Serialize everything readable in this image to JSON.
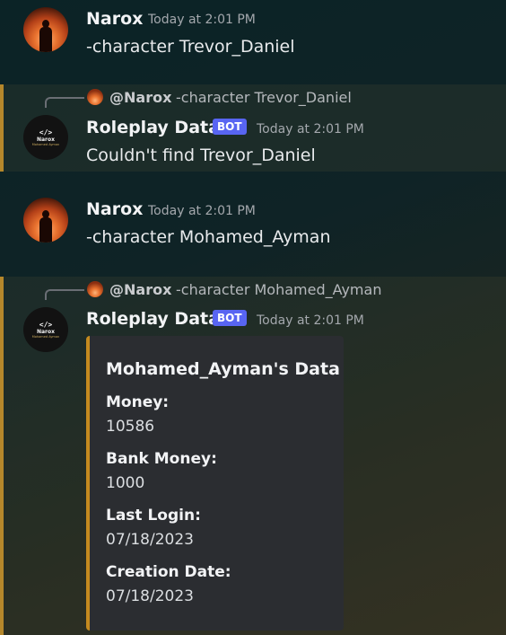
{
  "messages": [
    {
      "author": "Narox",
      "timestamp": "Today at 2:01 PM",
      "content": "-character Trevor_Daniel"
    },
    {
      "reply": {
        "user": "@Narox",
        "text": "-character Trevor_Daniel"
      },
      "author": "Roleplay Data",
      "badge": "BOT",
      "timestamp": "Today at 2:01 PM",
      "content": "Couldn't find Trevor_Daniel"
    },
    {
      "author": "Narox",
      "timestamp": "Today at 2:01 PM",
      "content": "-character Mohamed_Ayman"
    },
    {
      "reply": {
        "user": "@Narox",
        "text": "-character Mohamed_Ayman"
      },
      "author": "Roleplay Data",
      "badge": "BOT",
      "timestamp": "Today at 2:01 PM",
      "embed": {
        "title": "Mohamed_Ayman's Data",
        "accent_color": "#c48a1f",
        "fields": [
          {
            "name": "Money:",
            "value": "10586"
          },
          {
            "name": "Bank Money:",
            "value": "1000"
          },
          {
            "name": "Last Login:",
            "value": "07/18/2023"
          },
          {
            "name": "Creation Date:",
            "value": "07/18/2023"
          }
        ]
      }
    }
  ],
  "bot_avatar": {
    "code": "</>",
    "title": "Narox",
    "subtitle": "Mohamed Ayman"
  },
  "colors": {
    "bot_badge": "#5865f2",
    "mention_highlight": "#b5872b"
  },
  "icons": {
    "user_avatar": "sunset-silhouette-avatar",
    "bot_avatar": "code-logo-avatar"
  }
}
